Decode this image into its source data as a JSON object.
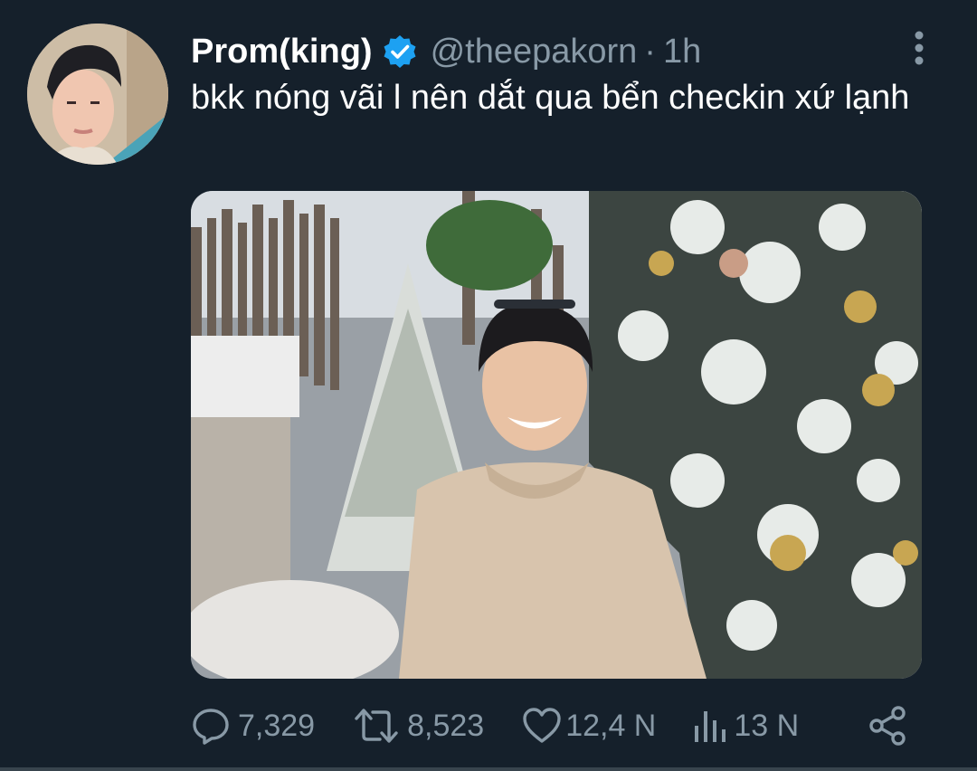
{
  "tweet": {
    "display_name": "Prom(king)",
    "handle": "@theepakorn",
    "separator": "·",
    "time": "1h",
    "text": "bkk nóng vãi l nên dắt qua bển checkin xứ lạnh",
    "verified_icon": "verified-badge-icon",
    "verified_color": "#1da1f2"
  },
  "actions": {
    "reply_count": "7,329",
    "retweet_count": "8,523",
    "like_count": "12,4 N",
    "views_count": "13 N"
  },
  "icons": {
    "more": "more-vertical-icon",
    "reply": "reply-icon",
    "retweet": "retweet-icon",
    "like": "heart-icon",
    "views": "views-icon",
    "share": "share-icon"
  },
  "colors": {
    "background": "#15202b",
    "muted": "#8899a6",
    "accent": "#1da1f2"
  }
}
